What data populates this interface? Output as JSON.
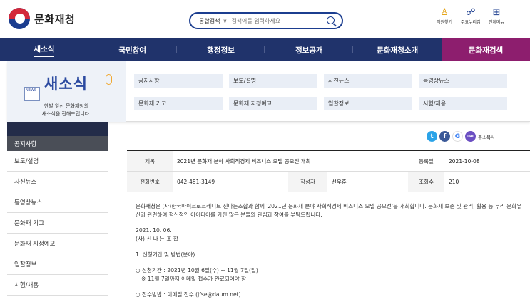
{
  "site": {
    "name": "문화재청"
  },
  "search": {
    "scope": "통합검색",
    "placeholder": "검색어를 입력하세요"
  },
  "util": [
    {
      "label": "직원찾기",
      "icon": "person-icon"
    },
    {
      "label": "주요누리집",
      "icon": "sitemap-icon"
    },
    {
      "label": "전체메뉴",
      "icon": "grid-icon"
    }
  ],
  "nav": [
    "새소식",
    "국민참여",
    "행정정보",
    "정보공개",
    "문화재청소개",
    "문화재검색"
  ],
  "mega": {
    "title": "새소식",
    "desc_line1": "한발 앞선 문화재청의",
    "desc_line2": "새소식을 전해드립니다.",
    "items": [
      "공지사항",
      "보도/설명",
      "사진뉴스",
      "동영상뉴스",
      "문화재 기고",
      "문화재 지정예고",
      "입찰정보",
      "시험/채용"
    ]
  },
  "sidebar": {
    "head": "공지사항",
    "items": [
      "보도/설명",
      "사진뉴스",
      "동영상뉴스",
      "문화재 기고",
      "문화재 지정예고",
      "입찰정보",
      "시험/채용"
    ]
  },
  "share": {
    "url_label": "주소복사",
    "url_badge": "URL"
  },
  "article": {
    "title_label": "제목",
    "title": "2021년 문화재 분야 사회적경제 비즈니스 모델 공모전 개최",
    "date_label": "등록일",
    "date": "2021-10-08",
    "phone_label": "전화번호",
    "phone": "042-481-3149",
    "author_label": "작성자",
    "author": "선우훈",
    "views_label": "조회수",
    "views": "210",
    "para1": "문화재청은 (사)한국마이크로크레디트 신나는조합과 함께 '2021년 문화재 분야 사회적경제 비즈니스 모델 공모전'을 개최합니다. 문화재 보존 및 관리, 활용 등 우리 문화유산과 관련하여 혁신적인 아이디어를 가진 많은 분들의 관심과 참여를 부탁드립니다.",
    "date_line": "2021. 10. 06.",
    "org_line": "(사) 신 나 는 조 합",
    "section1": "1. 신청기간 및 방법(분야)",
    "period": "○ 신청기간 : 2021년 10월 6일(수) ~ 11월 7일(일)",
    "period_note": "※ 11월 7일까지 이메일 접수가 완료되어야 함",
    "method": "○ 접수방법 : 이메일 접수 (jfse@daum.net)"
  }
}
